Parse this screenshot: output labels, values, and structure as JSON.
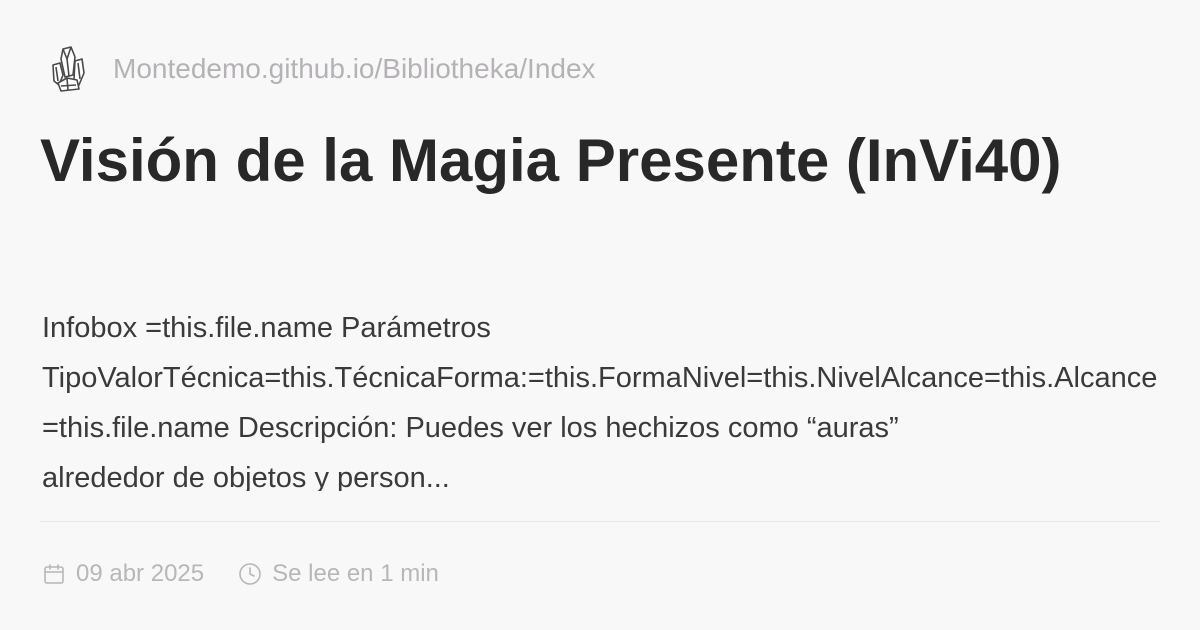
{
  "site": {
    "logo_icon": "crystal-cluster-icon",
    "url": "Montedemo.github.io/Bibliotheka/Index"
  },
  "article": {
    "title": "Visión de la Magia Presente (InVi40)",
    "description_lines": [
      "Infobox =this.file.name Parámetros",
      "TipoValorTécnica=this.TécnicaForma:=this.FormaNivel=this.NivelAlcance=this.Alcance",
      "=this.file.name Descripción: Puedes ver los hechizos como “auras”",
      "alrededor de objetos y person..."
    ]
  },
  "meta": {
    "date_icon": "calendar-icon",
    "date": "09 abr 2025",
    "read_time_icon": "clock-icon",
    "read_time": "Se lee en 1 min"
  },
  "colors": {
    "background": "#f9f8f9",
    "title": "#282828",
    "muted": "#b4b2b5"
  }
}
